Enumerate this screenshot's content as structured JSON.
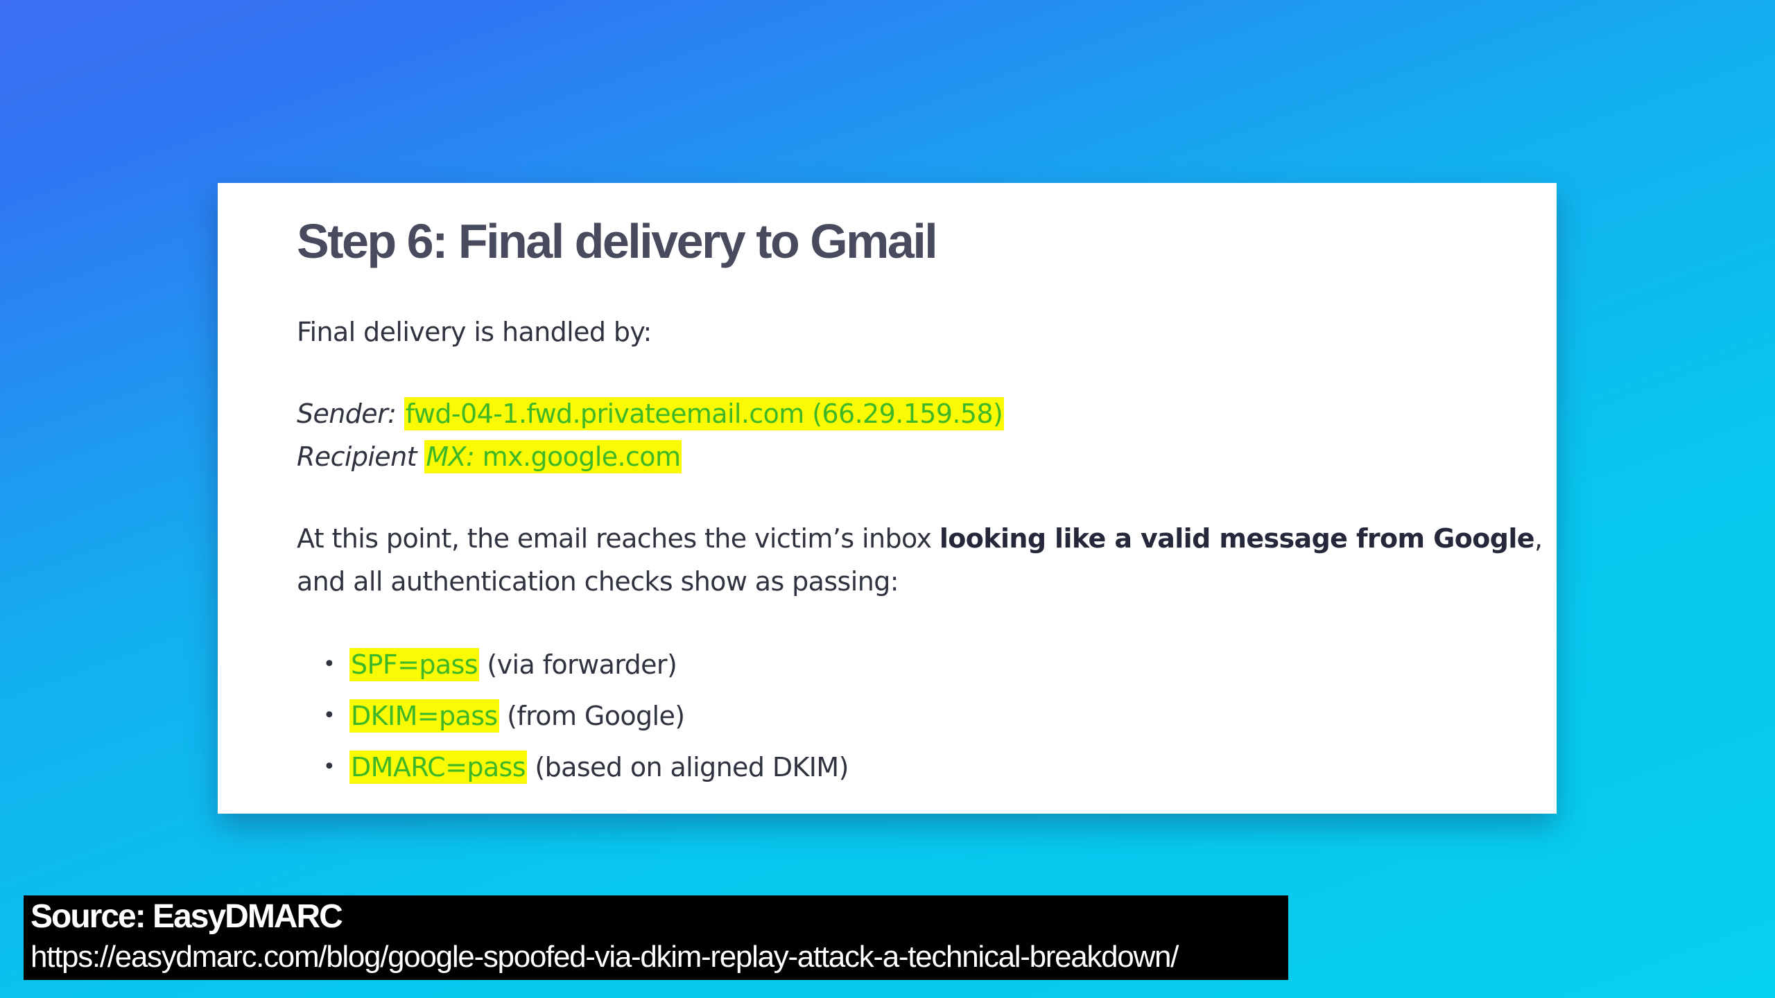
{
  "article": {
    "title": "Step 6: Final delivery to Gmail",
    "intro": "Final delivery is handled by:",
    "sender_label": "Sender:",
    "sender_value": "fwd-04-1.fwd.privateemail.com (66.29.159.58)",
    "recipient_label": "Recipient",
    "recipient_mx_label": "MX:",
    "recipient_value": "mx.google.com",
    "summary_start": "At this point, the email reaches the victim’s inbox ",
    "summary_bold": "looking like a valid message from Google",
    "summary_end": ",",
    "summary_line2": "and all authentication checks show as passing:",
    "checks": [
      {
        "result": "SPF=pass",
        "note": "(via forwarder)"
      },
      {
        "result": "DKIM=pass",
        "note": "(from Google)"
      },
      {
        "result": "DMARC=pass",
        "note": "(based on aligned DKIM)"
      }
    ],
    "bullet_glyph": "•"
  },
  "source": {
    "title": "Source: EasyDMARC",
    "url": "https://easydmarc.com/blog/google-spoofed-via-dkim-replay-attack-a-technical-breakdown/"
  },
  "colors": {
    "highlight_bg": "#fafa05",
    "highlight_text": "#3fb828",
    "title_text": "#484a5e",
    "body_text": "#2f3340"
  }
}
